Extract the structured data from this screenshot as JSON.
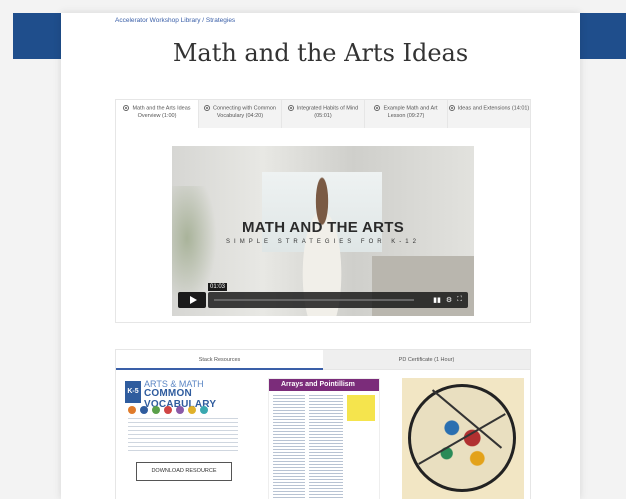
{
  "breadcrumb": "Accelerator Workshop Library / Strategies",
  "page_title": "Math and the Arts Ideas",
  "chapters": [
    {
      "label": "Math and the Arts Ideas Overview (1:00)"
    },
    {
      "label": "Connecting with Common Vocabulary (04:20)"
    },
    {
      "label": "Integrated Habits of Mind (05:01)"
    },
    {
      "label": "Example Math and Art Lesson (09:27)"
    },
    {
      "label": "Ideas and Extensions (14:01)"
    }
  ],
  "video": {
    "title": "MATH AND THE ARTS",
    "subtitle": "SIMPLE STRATEGIES FOR K-12",
    "time": "01:03"
  },
  "resources": {
    "tabs": [
      "Stack Resources",
      "PD Certificate (1 Hour)"
    ],
    "download_label": "DOWNLOAD RESOURCE",
    "thumb1": {
      "badge": "K-5",
      "line1": "ARTS & MATH",
      "line2": "COMMON VOCABULARY"
    },
    "thumb2": {
      "header": "Arrays and Pointillism"
    }
  },
  "colors": {
    "brand": "#1f4e8c",
    "link": "#3a5fa8",
    "purple": "#7b2c7a"
  }
}
